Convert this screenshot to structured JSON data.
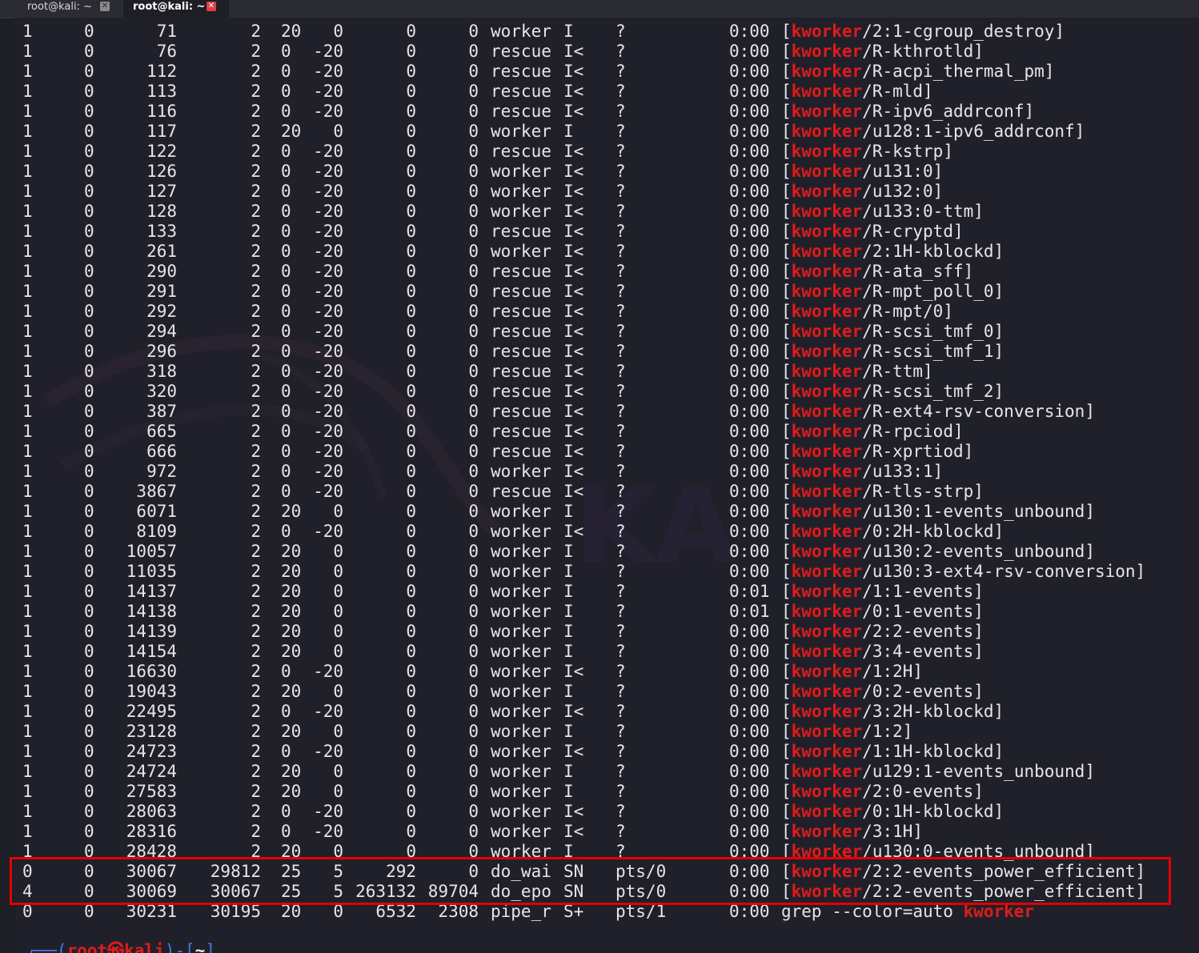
{
  "tabs": [
    {
      "label": "root@kali: ~",
      "active": false
    },
    {
      "label": "root@kali: ~",
      "active": true
    }
  ],
  "colors": {
    "background": "#20202a",
    "text": "#e6e6e6",
    "match": "#e01b1b",
    "highlight_box": "#e60000",
    "prompt": "#3d7be0"
  },
  "watermark_text": "KA",
  "match_term": "kworker",
  "rows": [
    [
      "1",
      "0",
      "71",
      "2",
      "20",
      "0",
      "0",
      "0",
      "worker",
      "I",
      "?",
      "0:00",
      "[",
      "kworker",
      "/2:1-cgroup_destroy]"
    ],
    [
      "1",
      "0",
      "76",
      "2",
      "0",
      "-20",
      "0",
      "0",
      "rescue",
      "I<",
      "?",
      "0:00",
      "[",
      "kworker",
      "/R-kthrotld]"
    ],
    [
      "1",
      "0",
      "112",
      "2",
      "0",
      "-20",
      "0",
      "0",
      "rescue",
      "I<",
      "?",
      "0:00",
      "[",
      "kworker",
      "/R-acpi_thermal_pm]"
    ],
    [
      "1",
      "0",
      "113",
      "2",
      "0",
      "-20",
      "0",
      "0",
      "rescue",
      "I<",
      "?",
      "0:00",
      "[",
      "kworker",
      "/R-mld]"
    ],
    [
      "1",
      "0",
      "116",
      "2",
      "0",
      "-20",
      "0",
      "0",
      "rescue",
      "I<",
      "?",
      "0:00",
      "[",
      "kworker",
      "/R-ipv6_addrconf]"
    ],
    [
      "1",
      "0",
      "117",
      "2",
      "20",
      "0",
      "0",
      "0",
      "worker",
      "I",
      "?",
      "0:00",
      "[",
      "kworker",
      "/u128:1-ipv6_addrconf]"
    ],
    [
      "1",
      "0",
      "122",
      "2",
      "0",
      "-20",
      "0",
      "0",
      "rescue",
      "I<",
      "?",
      "0:00",
      "[",
      "kworker",
      "/R-kstrp]"
    ],
    [
      "1",
      "0",
      "126",
      "2",
      "0",
      "-20",
      "0",
      "0",
      "worker",
      "I<",
      "?",
      "0:00",
      "[",
      "kworker",
      "/u131:0]"
    ],
    [
      "1",
      "0",
      "127",
      "2",
      "0",
      "-20",
      "0",
      "0",
      "worker",
      "I<",
      "?",
      "0:00",
      "[",
      "kworker",
      "/u132:0]"
    ],
    [
      "1",
      "0",
      "128",
      "2",
      "0",
      "-20",
      "0",
      "0",
      "worker",
      "I<",
      "?",
      "0:00",
      "[",
      "kworker",
      "/u133:0-ttm]"
    ],
    [
      "1",
      "0",
      "133",
      "2",
      "0",
      "-20",
      "0",
      "0",
      "rescue",
      "I<",
      "?",
      "0:00",
      "[",
      "kworker",
      "/R-cryptd]"
    ],
    [
      "1",
      "0",
      "261",
      "2",
      "0",
      "-20",
      "0",
      "0",
      "worker",
      "I<",
      "?",
      "0:00",
      "[",
      "kworker",
      "/2:1H-kblockd]"
    ],
    [
      "1",
      "0",
      "290",
      "2",
      "0",
      "-20",
      "0",
      "0",
      "rescue",
      "I<",
      "?",
      "0:00",
      "[",
      "kworker",
      "/R-ata_sff]"
    ],
    [
      "1",
      "0",
      "291",
      "2",
      "0",
      "-20",
      "0",
      "0",
      "rescue",
      "I<",
      "?",
      "0:00",
      "[",
      "kworker",
      "/R-mpt_poll_0]"
    ],
    [
      "1",
      "0",
      "292",
      "2",
      "0",
      "-20",
      "0",
      "0",
      "rescue",
      "I<",
      "?",
      "0:00",
      "[",
      "kworker",
      "/R-mpt/0]"
    ],
    [
      "1",
      "0",
      "294",
      "2",
      "0",
      "-20",
      "0",
      "0",
      "rescue",
      "I<",
      "?",
      "0:00",
      "[",
      "kworker",
      "/R-scsi_tmf_0]"
    ],
    [
      "1",
      "0",
      "296",
      "2",
      "0",
      "-20",
      "0",
      "0",
      "rescue",
      "I<",
      "?",
      "0:00",
      "[",
      "kworker",
      "/R-scsi_tmf_1]"
    ],
    [
      "1",
      "0",
      "318",
      "2",
      "0",
      "-20",
      "0",
      "0",
      "rescue",
      "I<",
      "?",
      "0:00",
      "[",
      "kworker",
      "/R-ttm]"
    ],
    [
      "1",
      "0",
      "320",
      "2",
      "0",
      "-20",
      "0",
      "0",
      "rescue",
      "I<",
      "?",
      "0:00",
      "[",
      "kworker",
      "/R-scsi_tmf_2]"
    ],
    [
      "1",
      "0",
      "387",
      "2",
      "0",
      "-20",
      "0",
      "0",
      "rescue",
      "I<",
      "?",
      "0:00",
      "[",
      "kworker",
      "/R-ext4-rsv-conversion]"
    ],
    [
      "1",
      "0",
      "665",
      "2",
      "0",
      "-20",
      "0",
      "0",
      "rescue",
      "I<",
      "?",
      "0:00",
      "[",
      "kworker",
      "/R-rpciod]"
    ],
    [
      "1",
      "0",
      "666",
      "2",
      "0",
      "-20",
      "0",
      "0",
      "rescue",
      "I<",
      "?",
      "0:00",
      "[",
      "kworker",
      "/R-xprtiod]"
    ],
    [
      "1",
      "0",
      "972",
      "2",
      "0",
      "-20",
      "0",
      "0",
      "worker",
      "I<",
      "?",
      "0:00",
      "[",
      "kworker",
      "/u133:1]"
    ],
    [
      "1",
      "0",
      "3867",
      "2",
      "0",
      "-20",
      "0",
      "0",
      "rescue",
      "I<",
      "?",
      "0:00",
      "[",
      "kworker",
      "/R-tls-strp]"
    ],
    [
      "1",
      "0",
      "6071",
      "2",
      "20",
      "0",
      "0",
      "0",
      "worker",
      "I",
      "?",
      "0:00",
      "[",
      "kworker",
      "/u130:1-events_unbound]"
    ],
    [
      "1",
      "0",
      "8109",
      "2",
      "0",
      "-20",
      "0",
      "0",
      "worker",
      "I<",
      "?",
      "0:00",
      "[",
      "kworker",
      "/0:2H-kblockd]"
    ],
    [
      "1",
      "0",
      "10057",
      "2",
      "20",
      "0",
      "0",
      "0",
      "worker",
      "I",
      "?",
      "0:00",
      "[",
      "kworker",
      "/u130:2-events_unbound]"
    ],
    [
      "1",
      "0",
      "11035",
      "2",
      "20",
      "0",
      "0",
      "0",
      "worker",
      "I",
      "?",
      "0:00",
      "[",
      "kworker",
      "/u130:3-ext4-rsv-conversion]"
    ],
    [
      "1",
      "0",
      "14137",
      "2",
      "20",
      "0",
      "0",
      "0",
      "worker",
      "I",
      "?",
      "0:01",
      "[",
      "kworker",
      "/1:1-events]"
    ],
    [
      "1",
      "0",
      "14138",
      "2",
      "20",
      "0",
      "0",
      "0",
      "worker",
      "I",
      "?",
      "0:01",
      "[",
      "kworker",
      "/0:1-events]"
    ],
    [
      "1",
      "0",
      "14139",
      "2",
      "20",
      "0",
      "0",
      "0",
      "worker",
      "I",
      "?",
      "0:00",
      "[",
      "kworker",
      "/2:2-events]"
    ],
    [
      "1",
      "0",
      "14154",
      "2",
      "20",
      "0",
      "0",
      "0",
      "worker",
      "I",
      "?",
      "0:00",
      "[",
      "kworker",
      "/3:4-events]"
    ],
    [
      "1",
      "0",
      "16630",
      "2",
      "0",
      "-20",
      "0",
      "0",
      "worker",
      "I<",
      "?",
      "0:00",
      "[",
      "kworker",
      "/1:2H]"
    ],
    [
      "1",
      "0",
      "19043",
      "2",
      "20",
      "0",
      "0",
      "0",
      "worker",
      "I",
      "?",
      "0:00",
      "[",
      "kworker",
      "/0:2-events]"
    ],
    [
      "1",
      "0",
      "22495",
      "2",
      "0",
      "-20",
      "0",
      "0",
      "worker",
      "I<",
      "?",
      "0:00",
      "[",
      "kworker",
      "/3:2H-kblockd]"
    ],
    [
      "1",
      "0",
      "23128",
      "2",
      "20",
      "0",
      "0",
      "0",
      "worker",
      "I",
      "?",
      "0:00",
      "[",
      "kworker",
      "/1:2]"
    ],
    [
      "1",
      "0",
      "24723",
      "2",
      "0",
      "-20",
      "0",
      "0",
      "worker",
      "I<",
      "?",
      "0:00",
      "[",
      "kworker",
      "/1:1H-kblockd]"
    ],
    [
      "1",
      "0",
      "24724",
      "2",
      "20",
      "0",
      "0",
      "0",
      "worker",
      "I",
      "?",
      "0:00",
      "[",
      "kworker",
      "/u129:1-events_unbound]"
    ],
    [
      "1",
      "0",
      "27583",
      "2",
      "20",
      "0",
      "0",
      "0",
      "worker",
      "I",
      "?",
      "0:00",
      "[",
      "kworker",
      "/2:0-events]"
    ],
    [
      "1",
      "0",
      "28063",
      "2",
      "0",
      "-20",
      "0",
      "0",
      "worker",
      "I<",
      "?",
      "0:00",
      "[",
      "kworker",
      "/0:1H-kblockd]"
    ],
    [
      "1",
      "0",
      "28316",
      "2",
      "0",
      "-20",
      "0",
      "0",
      "worker",
      "I<",
      "?",
      "0:00",
      "[",
      "kworker",
      "/3:1H]"
    ],
    [
      "1",
      "0",
      "28428",
      "2",
      "20",
      "0",
      "0",
      "0",
      "worker",
      "I",
      "?",
      "0:00",
      "[",
      "kworker",
      "/u130:0-events_unbound]"
    ],
    [
      "0",
      "0",
      "30067",
      "29812",
      "25",
      "5",
      "292",
      "0",
      "do_wai",
      "SN",
      "pts/0",
      "0:00",
      "[",
      "kworker",
      "/2:2-events_power_efficient]"
    ],
    [
      "4",
      "0",
      "30069",
      "30067",
      "25",
      "5",
      "263132",
      "89704",
      "do_epo",
      "SN",
      "pts/0",
      "0:00",
      "[",
      "kworker",
      "/2:2-events_power_efficient]"
    ],
    [
      "0",
      "0",
      "30231",
      "30195",
      "20",
      "0",
      "6532",
      "2308",
      "pipe_r",
      "S+",
      "pts/1",
      "0:00",
      "grep --color=auto ",
      "kworker",
      ""
    ]
  ],
  "prompt": {
    "open": "┌──(",
    "user_host": "root㉿kali",
    "mid": ")-[",
    "path": "~",
    "close": "]"
  }
}
